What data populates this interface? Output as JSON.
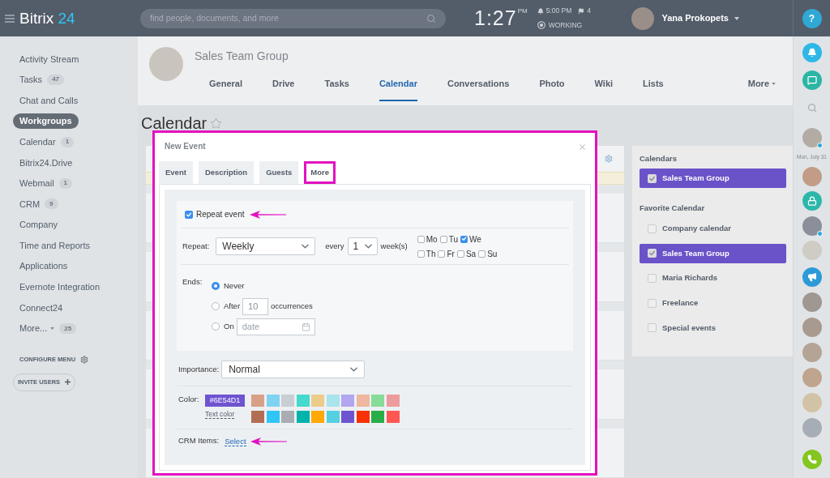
{
  "top_bar": {
    "logo": {
      "name": "Bitrix",
      "suffix": "24"
    },
    "search": {
      "placeholder": "find people, documents, and more"
    },
    "clock": {
      "time": "1:27",
      "period": "PM"
    },
    "reminder": "5:00 PM",
    "flags": "4",
    "status": "WORKING",
    "user": {
      "name": "Yana Prokopets"
    },
    "help": "?"
  },
  "sidebar": {
    "items": [
      {
        "label": "Activity Stream",
        "selected": false,
        "expandable": false
      },
      {
        "label": "Tasks",
        "badge": "47",
        "selected": false,
        "expandable": false
      },
      {
        "label": "Chat and Calls",
        "selected": false,
        "expandable": false
      },
      {
        "label": "Workgroups",
        "selected": true,
        "expandable": false
      },
      {
        "label": "Calendar",
        "badge": "1",
        "selected": false,
        "expandable": false
      },
      {
        "label": "Bitrix24.Drive",
        "selected": false,
        "expandable": false
      },
      {
        "label": "Webmail",
        "badge": "1",
        "selected": false,
        "expandable": false
      },
      {
        "label": "CRM",
        "badge": "9",
        "selected": false,
        "expandable": false
      },
      {
        "label": "Company",
        "selected": false,
        "expandable": false
      },
      {
        "label": "Time and Reports",
        "selected": false,
        "expandable": false
      },
      {
        "label": "Applications",
        "selected": false,
        "expandable": false
      },
      {
        "label": "Evernote Integration",
        "selected": false,
        "expandable": false
      },
      {
        "label": "Connect24",
        "selected": false,
        "expandable": false
      },
      {
        "label": "More...",
        "badge": "25",
        "selected": false,
        "expandable": true
      }
    ],
    "configure": "CONFIGURE MENU",
    "invite": "INVITE USERS"
  },
  "group": {
    "title": "Sales Team Group",
    "tabs": [
      {
        "label": "General",
        "selected": false,
        "expandable": false
      },
      {
        "label": "Drive",
        "selected": false,
        "expandable": false
      },
      {
        "label": "Tasks",
        "selected": false,
        "expandable": false
      },
      {
        "label": "Calendar",
        "selected": true,
        "expandable": false
      },
      {
        "label": "Conversations",
        "selected": false,
        "expandable": false
      },
      {
        "label": "Photo",
        "selected": false,
        "expandable": false
      },
      {
        "label": "Wiki",
        "selected": false,
        "expandable": false
      },
      {
        "label": "Lists",
        "selected": false,
        "expandable": false
      },
      {
        "label": "More",
        "selected": false,
        "expandable": true
      }
    ]
  },
  "page": {
    "title": "Calendar"
  },
  "dialog": {
    "title": "New Event",
    "tabs": [
      {
        "label": "Event",
        "selected": false,
        "highlighted": false
      },
      {
        "label": "Description",
        "selected": false,
        "highlighted": false
      },
      {
        "label": "Guests",
        "selected": false,
        "highlighted": false
      },
      {
        "label": "More",
        "selected": true,
        "highlighted": true
      }
    ],
    "repeat_event": {
      "label": "Repeat event",
      "checked": true
    },
    "repeat": {
      "label": "Repeat:",
      "frequency": "Weekly",
      "every": "every",
      "interval": "1",
      "unit": "week(s)",
      "days": [
        {
          "label": "Mo",
          "checked": false
        },
        {
          "label": "Tu",
          "checked": false
        },
        {
          "label": "We",
          "checked": true
        },
        {
          "label": "Th",
          "checked": false
        },
        {
          "label": "Fr",
          "checked": false
        },
        {
          "label": "Sa",
          "checked": false
        },
        {
          "label": "Su",
          "checked": false
        }
      ]
    },
    "ends": {
      "label": "Ends:",
      "options": [
        {
          "kind": "never",
          "label": "Never",
          "selected": true
        },
        {
          "kind": "count",
          "label": "After",
          "placeholder": "10",
          "suffix": "occurrences",
          "selected": false
        },
        {
          "kind": "date",
          "label": "On",
          "placeholder": "date",
          "selected": false
        }
      ]
    },
    "importance": {
      "label": "Importance:",
      "value": "Normal"
    },
    "color": {
      "label": "Color:",
      "value": "#6E54D1",
      "color": "#6e54d1",
      "text_color": "Text color",
      "swatches": [
        {
          "color": "#d9a088"
        },
        {
          "color": "#7fd3f1"
        },
        {
          "color": "#c9ced3"
        },
        {
          "color": "#46d9cd"
        },
        {
          "color": "#eccc8c"
        },
        {
          "color": "#a9e3ec"
        },
        {
          "color": "#b2a6f0"
        },
        {
          "color": "#efb6a0"
        },
        {
          "color": "#86dc98"
        },
        {
          "color": "#ec9c9c"
        },
        {
          "color": "#b26e52"
        },
        {
          "color": "#2fc6f6"
        },
        {
          "color": "#a8adb4"
        },
        {
          "color": "#00b4ac"
        },
        {
          "color": "#ffa900"
        },
        {
          "color": "#55d0e0"
        },
        {
          "color": "#6e54d1"
        },
        {
          "color": "#f73200"
        },
        {
          "color": "#29ad49"
        },
        {
          "color": "#ff5752"
        }
      ]
    },
    "crm": {
      "label": "CRM Items:",
      "link": "Select"
    }
  },
  "calendar_panel": {
    "sections": [
      {
        "title": "Calendars",
        "items": [
          {
            "label": "Sales Team Group",
            "checked": true
          }
        ]
      },
      {
        "title": "Favorite Calendar",
        "items": [
          {
            "label": "Company calendar",
            "checked": false
          },
          {
            "label": "Sales Team Group",
            "checked": true
          },
          {
            "label": "Maria Richards",
            "checked": false
          },
          {
            "label": "Freelance",
            "checked": false
          },
          {
            "label": "Special events",
            "checked": false
          }
        ]
      }
    ]
  },
  "right_rail": {
    "date": "Mon, July 31"
  }
}
